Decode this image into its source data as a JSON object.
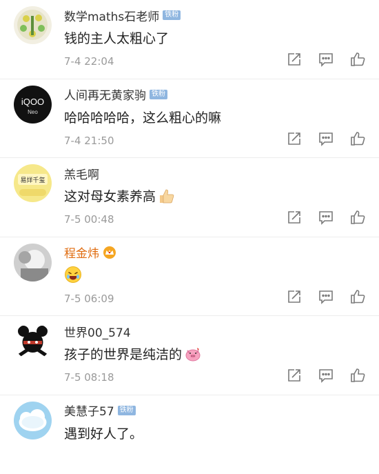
{
  "comments": [
    {
      "name": "数学maths石老师",
      "badge": "铁粉",
      "text": "钱的主人太粗心了",
      "time": "7-4 22:04"
    },
    {
      "name": "人间再无黄家驹",
      "badge": "铁粉",
      "text": "哈哈哈哈哈，这么粗心的嘛",
      "time": "7-4 21:50"
    },
    {
      "name": "羔毛啊",
      "text": "这对母女素养高",
      "time": "7-5 00:48"
    },
    {
      "name": "程金炜",
      "text": "",
      "time": "7-5 06:09"
    },
    {
      "name": "世界00_574",
      "text": "孩子的世界是纯洁的",
      "time": "7-5 08:18"
    },
    {
      "name": "美慧子57",
      "badge": "铁粉",
      "text": "遇到好人了。"
    }
  ],
  "avatars": {
    "a2_text": "iQOO",
    "a2_sub": "Neo",
    "a3_text": "易烊千玺"
  },
  "colors": {
    "badge": "#8fb6e0",
    "gold_name": "#e06c10",
    "icon": "#7a7a7a"
  }
}
